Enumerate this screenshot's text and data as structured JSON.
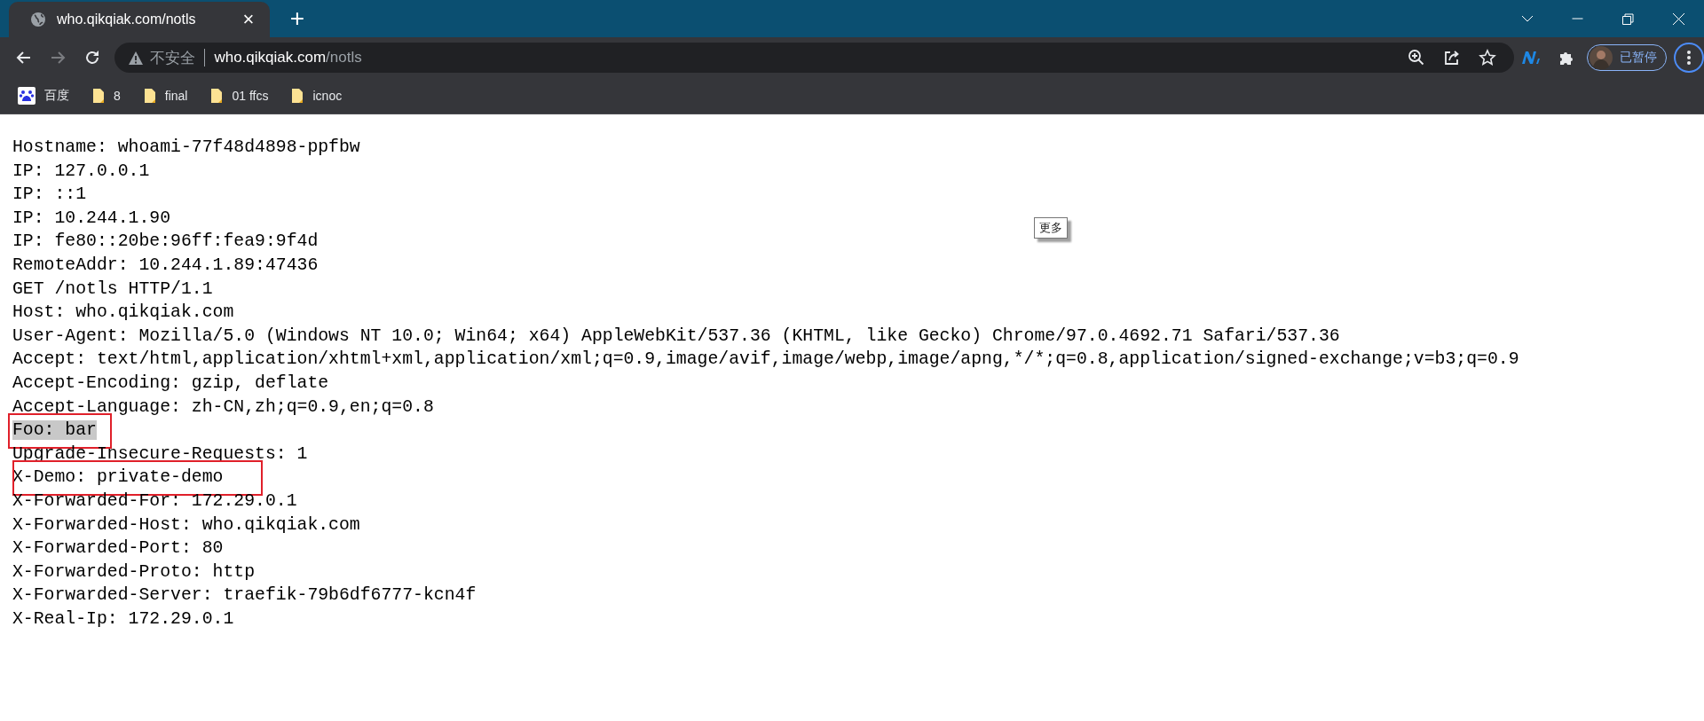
{
  "window": {
    "controls": [
      {
        "kind": "tab-search"
      },
      {
        "kind": "minimize"
      },
      {
        "kind": "restore"
      },
      {
        "kind": "close"
      }
    ]
  },
  "tabs": [
    {
      "title": "who.qikqiak.com/notls",
      "selected": true,
      "close": "×"
    }
  ],
  "new_tab": "+",
  "nav": [
    {
      "kind": "back",
      "disabled": false
    },
    {
      "kind": "forward",
      "disabled": true
    },
    {
      "kind": "reload",
      "disabled": false
    }
  ],
  "address": {
    "security": "不安全",
    "host": "who.qikqiak.com",
    "path": "/notls"
  },
  "profile": {
    "label": "已暂停"
  },
  "bookmarks": [
    {
      "label": "百度",
      "kind": "site"
    },
    {
      "label": "8",
      "kind": "folder"
    },
    {
      "label": "final",
      "kind": "folder"
    },
    {
      "label": "01 ffcs",
      "kind": "folder"
    },
    {
      "label": "icnoc",
      "kind": "folder"
    }
  ],
  "lines": [
    {
      "text": "Hostname: whoami-77f48d4898-ppfbw",
      "highlighted": false,
      "boxed": false
    },
    {
      "text": "IP: 127.0.0.1",
      "highlighted": false,
      "boxed": false
    },
    {
      "text": "IP: ::1",
      "highlighted": false,
      "boxed": false
    },
    {
      "text": "IP: 10.244.1.90",
      "highlighted": false,
      "boxed": false
    },
    {
      "text": "IP: fe80::20be:96ff:fea9:9f4d",
      "highlighted": false,
      "boxed": false
    },
    {
      "text": "RemoteAddr: 10.244.1.89:47436",
      "highlighted": false,
      "boxed": false
    },
    {
      "text": "GET /notls HTTP/1.1",
      "highlighted": false,
      "boxed": false
    },
    {
      "text": "Host: who.qikqiak.com",
      "highlighted": false,
      "boxed": false
    },
    {
      "text": "User-Agent: Mozilla/5.0 (Windows NT 10.0; Win64; x64) AppleWebKit/537.36 (KHTML, like Gecko) Chrome/97.0.4692.71 Safari/537.36",
      "highlighted": false,
      "boxed": false
    },
    {
      "text": "Accept: text/html,application/xhtml+xml,application/xml;q=0.9,image/avif,image/webp,image/apng,*/*;q=0.8,application/signed-exchange;v=b3;q=0.9",
      "highlighted": false,
      "boxed": false
    },
    {
      "text": "Accept-Encoding: gzip, deflate",
      "highlighted": false,
      "boxed": false
    },
    {
      "text": "Accept-Language: zh-CN,zh;q=0.9,en;q=0.8",
      "highlighted": false,
      "boxed": false
    },
    {
      "text": "Foo: bar",
      "highlighted": true,
      "boxed": true
    },
    {
      "text": "Upgrade-Insecure-Requests: 1",
      "highlighted": false,
      "boxed": false
    },
    {
      "text": "X-Demo: private-demo",
      "highlighted": false,
      "boxed": true
    },
    {
      "text": "X-Forwarded-For: 172.29.0.1",
      "highlighted": false,
      "boxed": false
    },
    {
      "text": "X-Forwarded-Host: who.qikqiak.com",
      "highlighted": false,
      "boxed": false
    },
    {
      "text": "X-Forwarded-Port: 80",
      "highlighted": false,
      "boxed": false
    },
    {
      "text": "X-Forwarded-Proto: http",
      "highlighted": false,
      "boxed": false
    },
    {
      "text": "X-Forwarded-Server: traefik-79b6df6777-kcn4f",
      "highlighted": false,
      "boxed": false
    },
    {
      "text": "X-Real-Ip: 172.29.0.1",
      "highlighted": false,
      "boxed": false
    }
  ],
  "tooltip": {
    "text": "更多"
  }
}
